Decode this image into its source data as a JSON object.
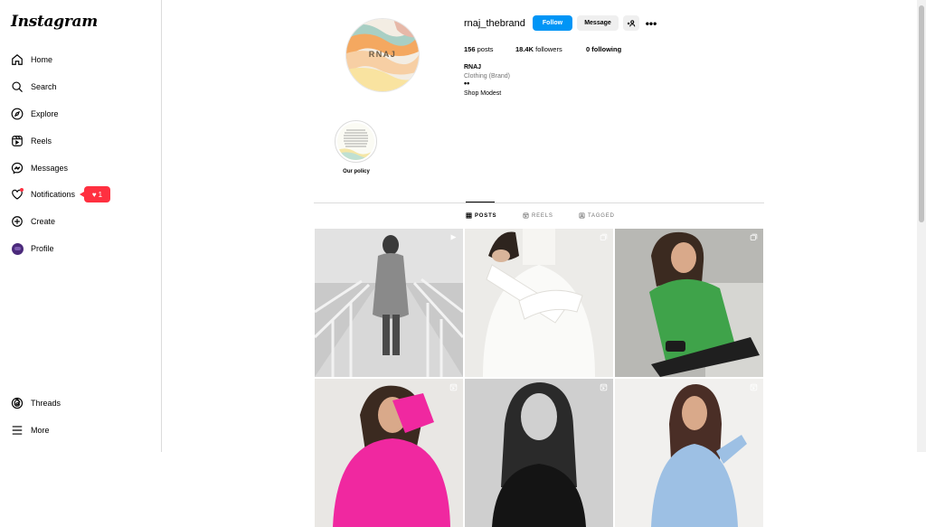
{
  "app": {
    "logo": "Instagram"
  },
  "sidebar": {
    "items": [
      {
        "label": "Home",
        "icon": "home-icon"
      },
      {
        "label": "Search",
        "icon": "search-icon"
      },
      {
        "label": "Explore",
        "icon": "compass-icon"
      },
      {
        "label": "Reels",
        "icon": "reels-icon"
      },
      {
        "label": "Messages",
        "icon": "messenger-icon"
      },
      {
        "label": "Notifications",
        "icon": "heart-icon"
      },
      {
        "label": "Create",
        "icon": "plus-square-icon"
      },
      {
        "label": "Profile",
        "icon": "avatar"
      }
    ],
    "notification_count": "1",
    "bottom": [
      {
        "label": "Threads",
        "icon": "threads-icon"
      },
      {
        "label": "More",
        "icon": "menu-icon"
      }
    ]
  },
  "profile": {
    "avatar_text": "RNAJ",
    "username": "rnaj_thebrand",
    "follow_label": "Follow",
    "message_label": "Message",
    "stats": {
      "posts_count": "156",
      "posts_label": "posts",
      "followers_count": "18.4K",
      "followers_label": "followers",
      "following_count": "0",
      "following_label": "following"
    },
    "name": "RNAJ",
    "category": "Clothing (Brand)",
    "bio_dots": "••",
    "bio": "Shop Modest"
  },
  "highlights": [
    {
      "label": "Our policy"
    }
  ],
  "tabs": [
    {
      "label": "POSTS",
      "active": true
    },
    {
      "label": "REELS",
      "active": false
    },
    {
      "label": "TAGGED",
      "active": false
    }
  ],
  "posts": [
    {
      "type": "reel",
      "description": "grey knit dress walkway"
    },
    {
      "type": "carousel",
      "description": "white knit sweater"
    },
    {
      "type": "carousel",
      "description": "green knit sweater"
    },
    {
      "type": "reel",
      "description": "pink knit sweater"
    },
    {
      "type": "reel",
      "description": "black top portrait"
    },
    {
      "type": "reel",
      "description": "blue knit sweater"
    }
  ],
  "colors": {
    "accent": "#0095f6",
    "badge": "#ff3040",
    "border": "#dbdbdb"
  }
}
